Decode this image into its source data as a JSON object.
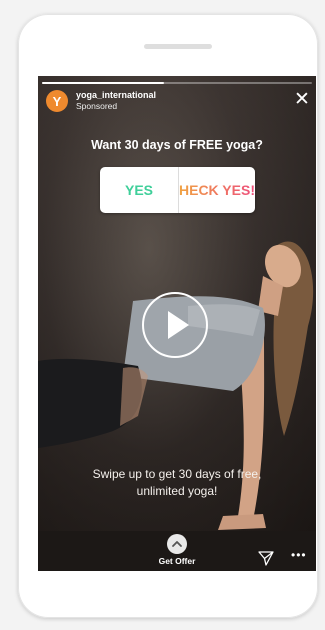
{
  "story": {
    "progress_fraction": 0.45,
    "account_name": "yoga_international",
    "sponsored_label": "Sponsored",
    "avatar_letter": "Y",
    "close_glyph": "✕",
    "question": "Want 30 days of FREE yoga?",
    "poll": {
      "option_yes": "YES",
      "option_heck": "HECK YES!"
    },
    "caption": "Swipe up to get 30 days of free, unlimited yoga!",
    "cta_label": "Get Offer",
    "more_glyph": "•••"
  },
  "colors": {
    "avatar": "#ef8a2e",
    "yes": "#3fcf9a",
    "heck_gradient_start": "#f0a342",
    "heck_gradient_end": "#ee4e7c"
  },
  "icons": [
    "play-icon",
    "chevron-up-icon",
    "paper-plane-icon",
    "more-icon",
    "close-icon"
  ]
}
